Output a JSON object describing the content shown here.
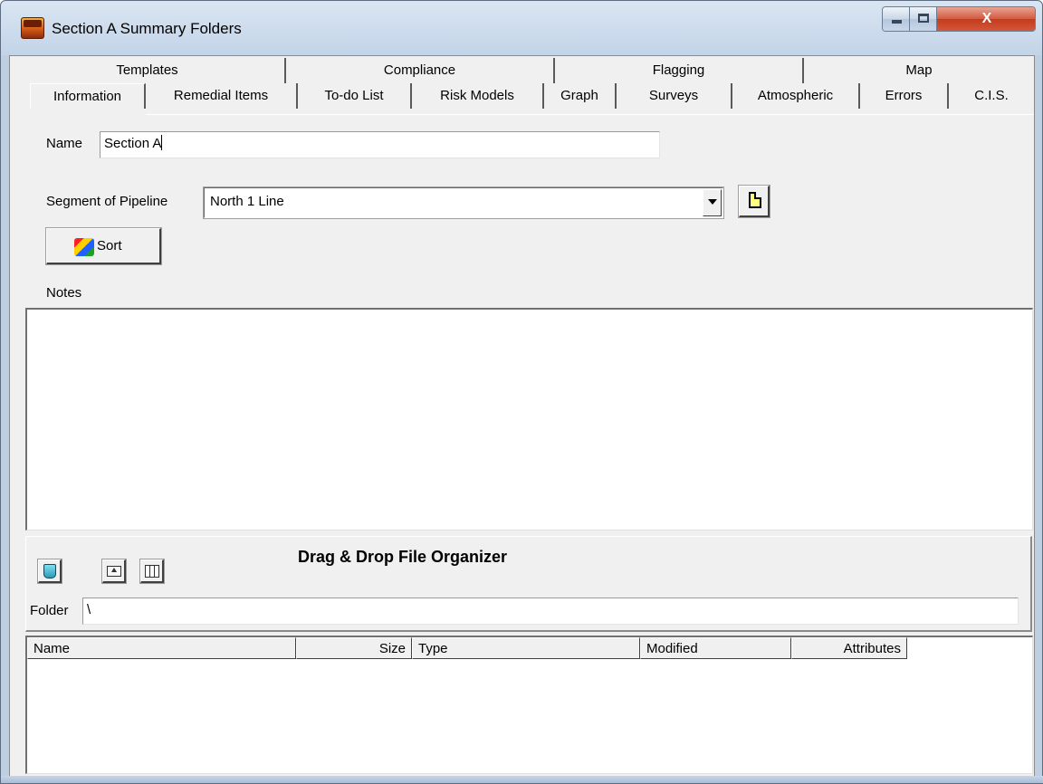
{
  "window": {
    "title": "Section A Summary Folders",
    "close_glyph": "X",
    "colors": {
      "frame": "#bfcfe2",
      "close": "#c43b1e",
      "client": "#f0f0f0"
    }
  },
  "tabs": {
    "row_back": [
      "Templates",
      "Compliance",
      "Flagging",
      "Map"
    ],
    "row_front": [
      "Information",
      "Remedial Items",
      "To-do List",
      "Risk Models",
      "Graph",
      "Surveys",
      "Atmospheric",
      "Errors",
      "C.I.S."
    ],
    "active": "Information"
  },
  "form": {
    "name_label": "Name",
    "name_value": "Section A",
    "segment_label": "Segment of Pipeline",
    "segment_value": "North 1 Line",
    "sort_label": "Sort",
    "notes_label": "Notes",
    "notes_value": ""
  },
  "organizer": {
    "title": "Drag & Drop File Organizer",
    "folder_label": "Folder",
    "folder_value": "\\",
    "tool_icons": [
      "recycle-bin-icon",
      "up-folder-icon",
      "details-view-icon"
    ]
  },
  "file_list": {
    "columns": [
      "Name",
      "Size",
      "Type",
      "Modified",
      "Attributes"
    ],
    "rows": []
  }
}
